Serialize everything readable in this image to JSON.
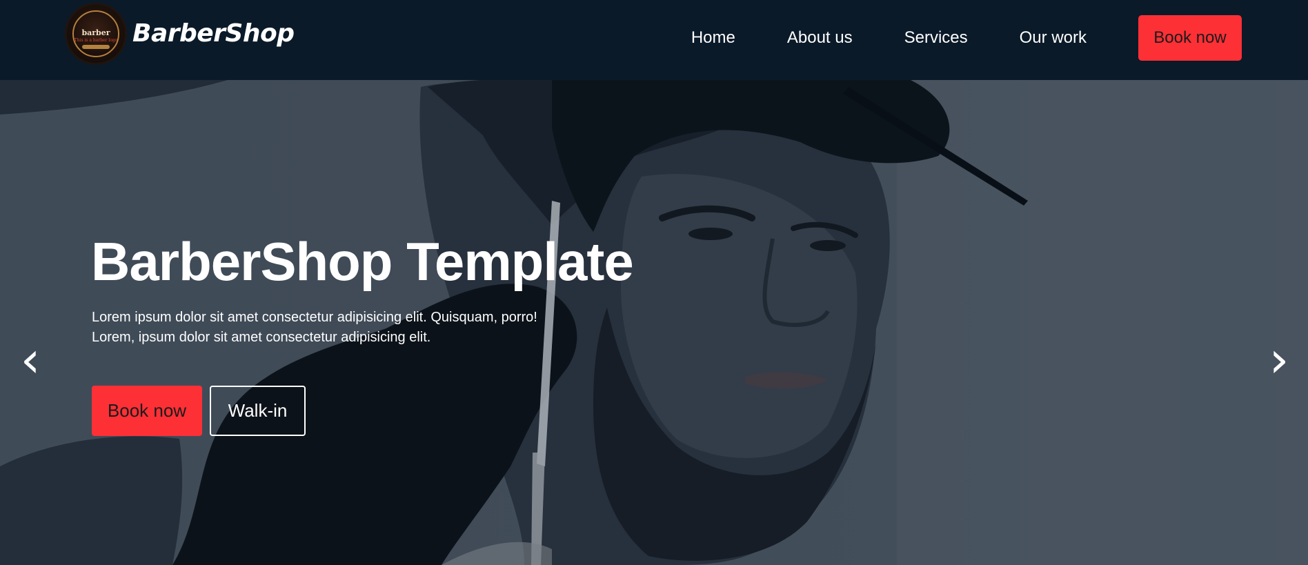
{
  "brand": {
    "name": "BarberShop",
    "logo_text": "barber",
    "logo_tagline": "This is a barber logo"
  },
  "nav": {
    "links": [
      "Home",
      "About us",
      "Services",
      "Our work"
    ],
    "cta_label": "Book now"
  },
  "hero": {
    "title": "BarberShop Template",
    "subtitle_lines": [
      "Lorem ipsum dolor sit amet consectetur adipisicing elit. Quisquam, porro!",
      "Lorem, ipsum dolor sit amet consectetur adipisicing elit."
    ],
    "primary_button": "Book now",
    "secondary_button": "Walk-in"
  },
  "carousel": {
    "prev_icon": "‹",
    "next_icon": "›"
  },
  "colors": {
    "navbar_bg": "#0b1a29",
    "accent": "#fd3036",
    "text_light": "#ffffff"
  },
  "icons": {
    "prev": "chevron-left-icon",
    "next": "chevron-right-icon"
  }
}
